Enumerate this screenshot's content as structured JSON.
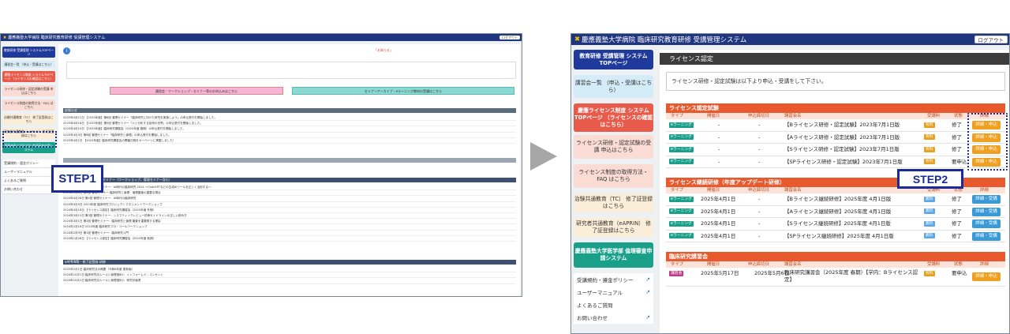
{
  "app": {
    "title": "慶應義塾大学病院 臨床研究教育研修 受講管理システム",
    "logout_label": "ログアウト"
  },
  "left_screen": {
    "sidebar": [
      {
        "label": "教育研修 受講管理 システムTOPページ",
        "bg": "#1f3a9a",
        "fg": "#ffffff"
      },
      {
        "label": "講習会一覧 （申込・受講はこちら）",
        "bg": "#d7ecf7",
        "fg": "#333333"
      },
      {
        "label": "慶應ライセンス制度 システムTOPページ （ライセンスの確認はこちら）",
        "bg": "#e85a4a",
        "fg": "#ffffff"
      },
      {
        "label": "ライセンス研修・認定試験の受講 申込はこちら",
        "bg": "#fbdcd4",
        "fg": "#333333"
      },
      {
        "label": "ライセンス制度の取得方法・FAQ はこちら",
        "bg": "#fbdcd4",
        "fg": "#333333"
      },
      {
        "label": "治験共通教育（TC） 修了証登録はこちら",
        "bg": "#fbeed8",
        "fg": "#333333"
      },
      {
        "label": "研究者共通教育（eAPRIN） 修了証登録はこちら",
        "bg": "#fbeed8",
        "fg": "#333333"
      },
      {
        "label": "慶應義塾大学医学部 倫理審査申請システム",
        "bg": "#1aa08a",
        "fg": "#ffffff"
      }
    ],
    "menu": [
      "受講規約・遵金ポリシー",
      "ユーザーマニュアル",
      "よくあるご質問",
      "お問い合わせ"
    ],
    "notice": "「お知らせ」",
    "pink_bar": "講習会・ワークショップ・セミナー等のお申込みはこちら",
    "teal_bar": "セミナーアーカイブ・eラーニング教材の受講はこちら",
    "section_news": "お知らせ",
    "news_rows": [
      "2025年4月21日 【2025年度】第6回 管理セミナー「臨床研究に向けた研究を実施しよう」の申込受付を開始しました。",
      "2025年4月16日 【2025年度】第5回 管理セミナー「人と分析する症例の世界」の申込受付を開始しました。",
      "2025年4月10日 【2025年度】臨床研究講習会（2025年度 春期）の申込受付を開始しました。",
      "2025年4月3日 第6回 管理セミナー「臨床研究と倫理」の申込受付を開始しました。",
      "2025年4月1日 【2025年度】臨床研究講習会の開催日程をカーベージに掲載しました！"
    ],
    "section_list": "臨床研究に関する講習会・セミナー（ワークショップ、管理セミナー含む）",
    "list_rows": [
      "2024年5月10日 第6回 管理セミナー：AI時代の臨床研究 2024 〜ChatGPTなどの生成AIツールを正しく活用する〜",
      "2024年5月8日 第5回 管理セミナー 臨床研究と倫理：倫理審査の重要な視点",
      "2024年4月26日 第4回 管理セミナー：AI時代の臨床研究",
      "2024年4月5日 2023年度 臨床研究プロジェクトマネジメントワークショップ",
      "2024年4月18日 【ライセンス認定】臨床研究講習会（2023年度 冬期）",
      "2024年3月15日 第3回 管理セミナー：シスマティックレビュー診療ガイドラインの正しい読み方",
      "2024年3月1日 第2回 管理セミナー：臨床研究と倫理 審査を重要視する理由",
      "2024年2月16日 2023年度 臨床研究プロ・コールワークショップ",
      "2024年2月9日 第1回 管理セミナー：臨床研究入門",
      "2024年1月26日 【ライセンス認定】臨床研究講習会（2023年度 秋期）"
    ],
    "section_elearn": "eAPRIN等・修了証登録 研修",
    "elearn_rows": [
      "2025年2月1日 臨床研究法の概要（令和6年度 更新版）",
      "2024年10月1日 臨床研究法ルールと倫理指針1：インフォームド・コンセント",
      "2024年10月1日 臨床研究法ルールと倫理指針2：研究計画書"
    ]
  },
  "step1_label": "STEP1",
  "right_screen": {
    "sidebar": [
      {
        "label": "教育研修 受講管理 システムTOPページ",
        "bg": "#1f3a9a",
        "fg": "#ffffff"
      },
      {
        "label": "講習会一覧 （申込・受講はこちら）",
        "bg": "#d4ebf8",
        "fg": "#333333"
      },
      {
        "label": "慶應ライセンス制度 システムTOPページ （ライセンスの確認はこちら）",
        "bg": "#e85a4a",
        "fg": "#ffffff"
      },
      {
        "label": "ライセンス研修・認定試験の受講 申込はこちら",
        "bg": "#fbdcd4",
        "fg": "#333333"
      },
      {
        "label": "ライセンス制度の取得方法・FAQ はこちら",
        "bg": "#fbdcd4",
        "fg": "#333333"
      },
      {
        "label": "治験共通教育（TC） 修了証登録はこちら",
        "bg": "#fbeed8",
        "fg": "#333333"
      },
      {
        "label": "研究者共通教育（eAPRIN） 修了証登録はこちら",
        "bg": "#fbeed8",
        "fg": "#333333"
      },
      {
        "label": "慶應義塾大学医学部 倫理審査申請システム",
        "bg": "#1aa08a",
        "fg": "#ffffff"
      }
    ],
    "menu": [
      "受講規約・遵金ポリシー",
      "ユーザーマニュアル",
      "よくあるご質問",
      "お問い合わせ"
    ],
    "page_title": "ライセンス認定",
    "info": "ライセンス研修・認定試験は以下より申込・受講をして下さい。",
    "columns": [
      "タイプ",
      "開催日",
      "申込締切日",
      "講習会名",
      "受講料",
      "状態",
      "詳細"
    ],
    "sections": [
      {
        "title": "ライセンス認定試験",
        "rows": [
          {
            "type": "eラーニング",
            "date": "-",
            "deadline": "-",
            "name": "【Bライセンス研修・認定試験】2023年7月1日版",
            "fee": "有料",
            "status": "修了",
            "action": "詳細・申込"
          },
          {
            "type": "eラーニング",
            "date": "-",
            "deadline": "-",
            "name": "【Aライセンス研修・認定試験】2023年7月1日版",
            "fee": "有料",
            "status": "修了",
            "action": "詳細・申込"
          },
          {
            "type": "eラーニング",
            "date": "-",
            "deadline": "-",
            "name": "【Sライセンス研修・認定試験】2023年7月1日版",
            "fee": "有料",
            "status": "修了",
            "action": "詳細・申込"
          },
          {
            "type": "eラーニング",
            "date": "-",
            "deadline": "-",
            "name": "【SPライセンス研修・認定試験】2023年7月1日版",
            "fee": "有料",
            "status": "要申込",
            "action": "詳細・申込"
          }
        ]
      },
      {
        "title": "ライセンス継続研修（年度アップデート研修）",
        "rows": [
          {
            "type": "eラーニング",
            "date": "2025年4月1日",
            "deadline": "-",
            "name": "【Bライセンス継続研修】2025年度 4月1日版",
            "fee": "無料",
            "status": "修了",
            "action": "詳細・受講"
          },
          {
            "type": "eラーニング",
            "date": "2025年4月1日",
            "deadline": "-",
            "name": "【Aライセンス継続研修】2025年度 4月1日版",
            "fee": "無料",
            "status": "修了",
            "action": "詳細・受講"
          },
          {
            "type": "eラーニング",
            "date": "2025年4月1日",
            "deadline": "-",
            "name": "【Sライセンス継続研修】2025年度 4月1日版",
            "fee": "無料",
            "status": "修了",
            "action": "詳細・受講"
          },
          {
            "type": "eラーニング",
            "date": "2025年4月1日",
            "deadline": "-",
            "name": "【SPライセンス継続研修】2025年度 4月1日版",
            "fee": "無料",
            "status": "修了",
            "action": "詳細・受講"
          }
        ]
      },
      {
        "title": "臨床研究講習会",
        "rows": [
          {
            "type": "講習会",
            "date": "2025年5月17日",
            "deadline": "2025年5月6日",
            "name": "臨床研究講習会（2025年度 春期）【学内：Bライセンス認定】",
            "fee": "有料",
            "status": "要申込",
            "action": "詳細・申込"
          }
        ]
      }
    ]
  },
  "step2_label": "STEP2",
  "colors": {
    "header": "#1f3580",
    "section_orange": "#e85a2e",
    "button_orange": "#f0a020",
    "button_blue": "#3a9ad8",
    "badge_elearning": "#1aa08a",
    "badge_lecture": "#c03a8a",
    "fee_paid": "#e8a020",
    "fee_free": "#5aa8e8",
    "step_blue": "#1a2b99"
  }
}
